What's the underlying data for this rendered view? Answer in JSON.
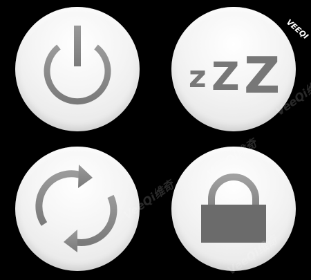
{
  "watermark": {
    "corner": "VEEQI",
    "repeated": "VeeQi维奇"
  },
  "buttons": [
    {
      "id": "power",
      "icon": "power-icon"
    },
    {
      "id": "sleep",
      "icon": "sleep-zzz-icon",
      "glyphs": [
        "z",
        "Z",
        "Z"
      ]
    },
    {
      "id": "refresh",
      "icon": "refresh-icon"
    },
    {
      "id": "lock",
      "icon": "padlock-icon"
    }
  ],
  "colors": {
    "background": "#000000",
    "button_face": "#f2f2f2",
    "icon_gray": "#8a8a8a",
    "icon_dark": "#6e6e6e"
  }
}
